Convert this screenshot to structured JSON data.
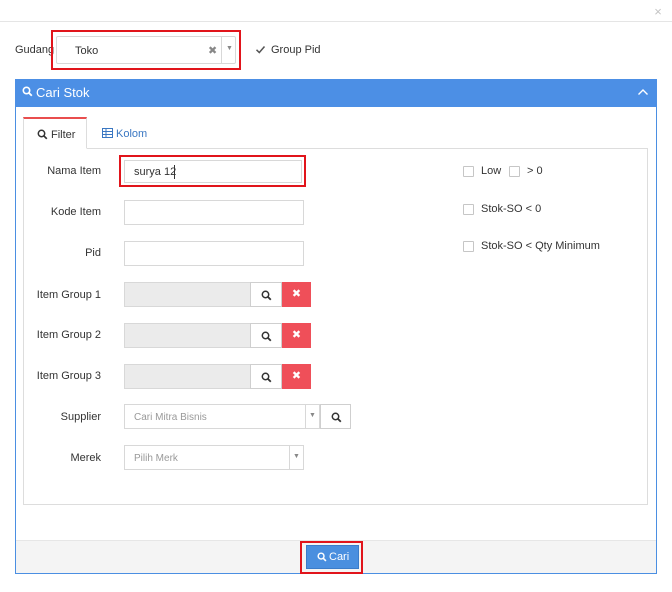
{
  "dialog": {
    "close_symbol": "×"
  },
  "header": {
    "gudang_label": "Gudang",
    "gudang_value": "Toko",
    "gudang_clear": "✖",
    "gudang_arrow": "▼",
    "group_pid_label": "Group Pid",
    "group_pid_checked": true
  },
  "panel": {
    "title": "Cari Stok",
    "collapse_icon": "chevron-up-icon"
  },
  "tabs": [
    {
      "label": "Filter",
      "icon": "search-icon",
      "active": true
    },
    {
      "label": "Kolom",
      "icon": "table-icon",
      "active": false
    }
  ],
  "form": {
    "nama_item": {
      "label": "Nama Item",
      "value": "surya 12"
    },
    "kode_item": {
      "label": "Kode Item",
      "value": ""
    },
    "pid": {
      "label": "Pid",
      "value": ""
    },
    "item_group_1": {
      "label": "Item Group 1",
      "value": ""
    },
    "item_group_2": {
      "label": "Item Group 2",
      "value": ""
    },
    "item_group_3": {
      "label": "Item Group 3",
      "value": ""
    },
    "clear_symbol": "✖",
    "supplier": {
      "label": "Supplier",
      "placeholder": "Cari Mitra Bisnis",
      "arrow": "▼"
    },
    "merek": {
      "label": "Merek",
      "placeholder": "Pilih Merk",
      "arrow": "▼"
    }
  },
  "checks": {
    "low": {
      "label": "Low",
      "checked": false
    },
    "gt_zero": {
      "label": "> 0",
      "checked": false
    },
    "stok_so_lt_zero": {
      "label": "Stok-SO < 0",
      "checked": false
    },
    "stok_so_lt_qty_min": {
      "label": "Stok-SO < Qty Minimum",
      "checked": false
    }
  },
  "footer": {
    "cari_label": "Cari"
  },
  "colors": {
    "panel_header": "#4c8fe5",
    "clear_button": "#ef4f59",
    "highlight": "#e1141b",
    "tab_accent": "#e94e4e"
  }
}
